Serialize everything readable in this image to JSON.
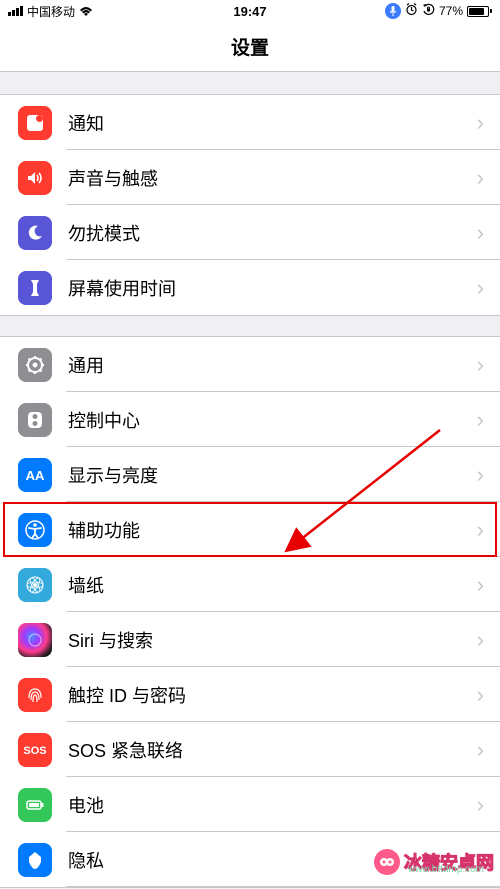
{
  "status": {
    "carrier": "中国移动",
    "time": "19:47",
    "battery_pct": "77%"
  },
  "header": {
    "title": "设置"
  },
  "group1": [
    {
      "label": "通知",
      "icon": "notifications-icon",
      "bg": "bg-red"
    },
    {
      "label": "声音与触感",
      "icon": "sounds-icon",
      "bg": "bg-red"
    },
    {
      "label": "勿扰模式",
      "icon": "dnd-icon",
      "bg": "bg-purple"
    },
    {
      "label": "屏幕使用时间",
      "icon": "screentime-icon",
      "bg": "bg-purple"
    }
  ],
  "group2": [
    {
      "label": "通用",
      "icon": "general-icon",
      "bg": "bg-gray"
    },
    {
      "label": "控制中心",
      "icon": "control-center-icon",
      "bg": "bg-gray"
    },
    {
      "label": "显示与亮度",
      "icon": "display-icon",
      "bg": "bg-blue"
    },
    {
      "label": "辅助功能",
      "icon": "accessibility-icon",
      "bg": "bg-blue",
      "highlight": true
    },
    {
      "label": "墙纸",
      "icon": "wallpaper-icon",
      "bg": "bg-cyan"
    },
    {
      "label": "Siri 与搜索",
      "icon": "siri-icon",
      "bg": "bg-black"
    },
    {
      "label": "触控 ID 与密码",
      "icon": "touchid-icon",
      "bg": "bg-red"
    },
    {
      "label": "SOS 紧急联络",
      "icon": "sos-icon",
      "bg": "bg-red"
    },
    {
      "label": "电池",
      "icon": "battery-icon",
      "bg": "bg-green"
    },
    {
      "label": "隐私",
      "icon": "privacy-icon",
      "bg": "bg-blue"
    }
  ],
  "watermark": {
    "text": "冰糖安卓网",
    "sub": "www.bttdmp.com"
  },
  "annotation": {
    "arrow_target": "辅助功能"
  }
}
